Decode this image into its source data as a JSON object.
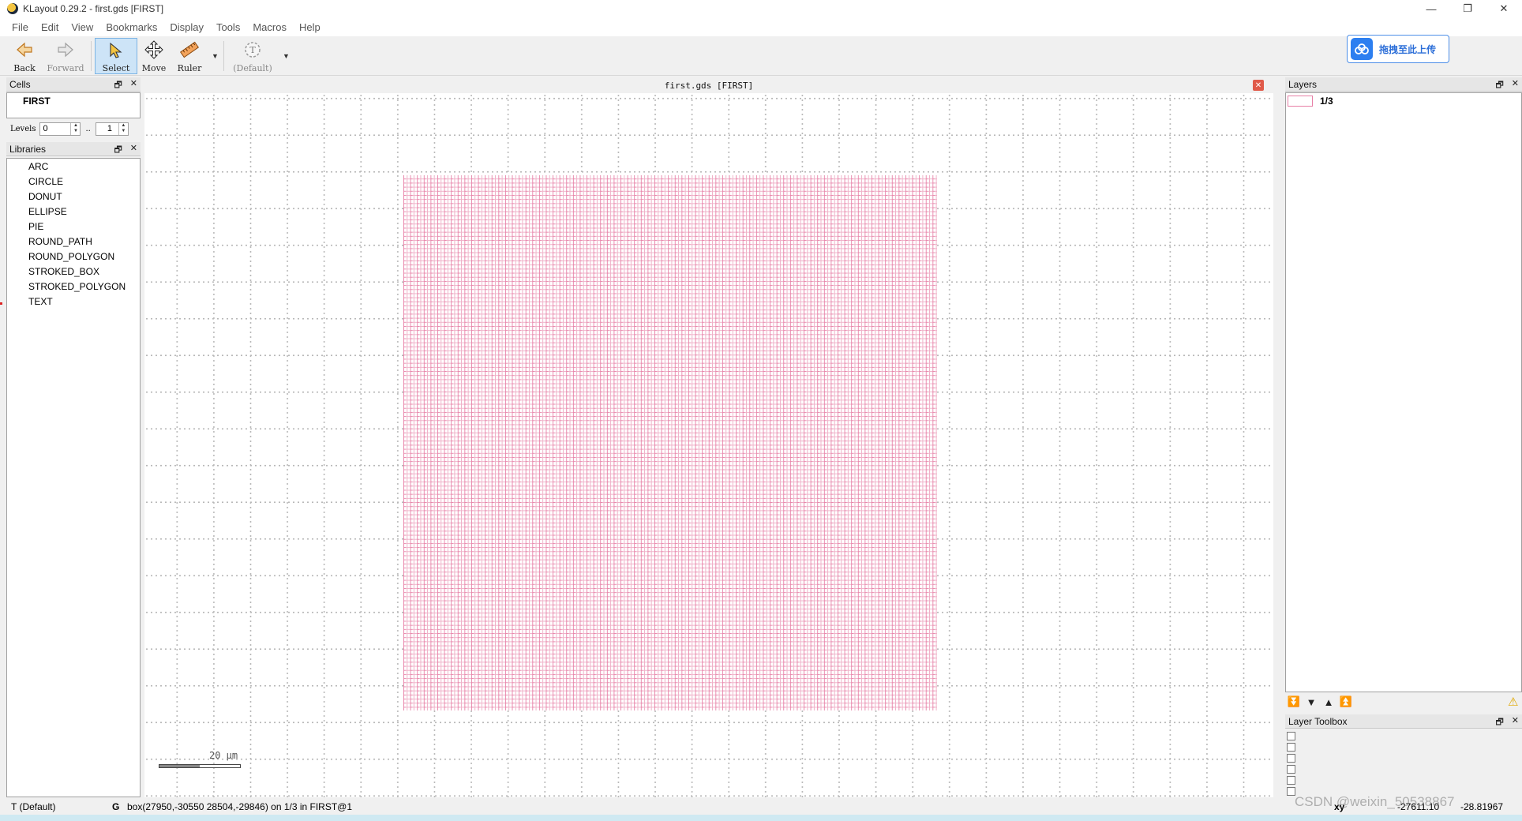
{
  "window": {
    "title": "KLayout 0.29.2 - first.gds [FIRST]",
    "controls": [
      "—",
      "❐",
      "✕"
    ]
  },
  "menu": [
    "File",
    "Edit",
    "View",
    "Bookmarks",
    "Display",
    "Tools",
    "Macros",
    "Help"
  ],
  "toolbar": {
    "back": "Back",
    "forward": "Forward",
    "select": "Select",
    "move": "Move",
    "ruler": "Ruler",
    "default": "(Default)",
    "upload": "拖拽至此上传"
  },
  "cells": {
    "title": "Cells",
    "items": [
      "FIRST"
    ],
    "levels_label": "Levels",
    "level_from": "0",
    "level_sep": "..",
    "level_to": "1"
  },
  "libraries": {
    "title": "Libraries",
    "items": [
      "ARC",
      "CIRCLE",
      "DONUT",
      "ELLIPSE",
      "PIE",
      "ROUND_PATH",
      "ROUND_POLYGON",
      "STROKED_BOX",
      "STROKED_POLYGON",
      "TEXT"
    ]
  },
  "canvas": {
    "title": "first.gds [FIRST]",
    "close": "✕",
    "scale": "20 µm",
    "layer_color": "#e77fa6"
  },
  "layers": {
    "title": "Layers",
    "items": [
      {
        "name": "1/3",
        "color": "#e77fa6"
      }
    ]
  },
  "layer_toolbox": {
    "title": "Layer Toolbox"
  },
  "status": {
    "mode": "T  (Default)",
    "g": "G",
    "message": "box(27950,-30550 28504,-29846) on 1/3 in FIRST@1",
    "xy": "xy",
    "x": "-27611.10",
    "y": "-28.81967"
  },
  "watermark": "CSDN @weixin_50538867"
}
